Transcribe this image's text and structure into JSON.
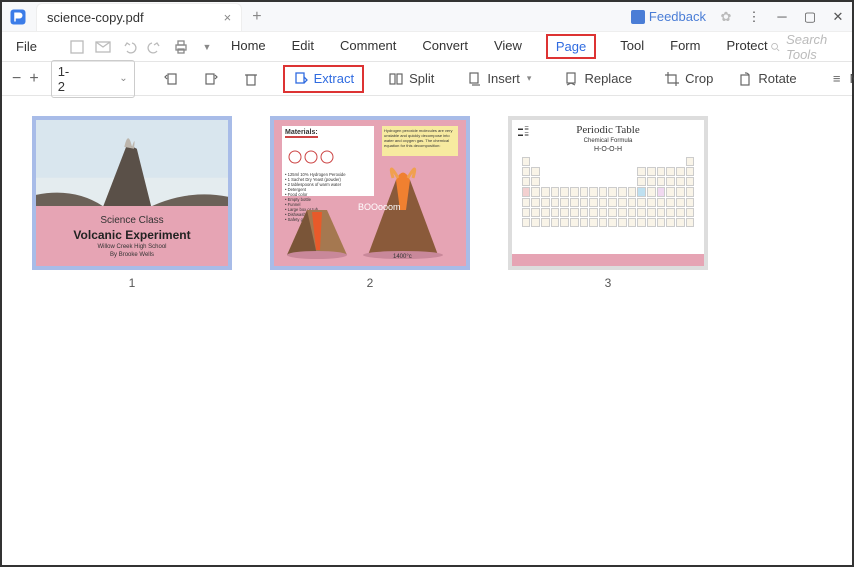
{
  "titlebar": {
    "filename": "science-copy.pdf",
    "feedback": "Feedback"
  },
  "menu": {
    "file": "File",
    "items": [
      "Home",
      "Edit",
      "Comment",
      "Convert",
      "View",
      "Page",
      "Tool",
      "Form",
      "Protect"
    ],
    "active": "Page",
    "search_placeholder": "Search Tools"
  },
  "toolbar": {
    "page_range": "1-2",
    "extract": "Extract",
    "split": "Split",
    "insert": "Insert",
    "replace": "Replace",
    "crop": "Crop",
    "rotate": "Rotate",
    "more": "More"
  },
  "thumbs": {
    "labels": [
      "1",
      "2",
      "3"
    ]
  },
  "slide1": {
    "line1": "Science Class",
    "line2": "Volcanic Experiment",
    "line3": "Willow Creek High School",
    "line4": "By Brooke Wells"
  },
  "slide2": {
    "materials_hdr": "Materials:",
    "materials_list": "• 125ml 10% Hydrogen Peroxide\n• 1 Sachet Dry Yeast (powder)\n• 2 tablespoons of warm water\n• Detergent\n• Food color\n• Empty bottle\n• Funnel\n• Large box or tub\n• Dishwashing gloves\n• Safety goggles",
    "note": "Hydrogen peroxide molecules are very unstable and quickly decompose into water and oxygen gas. The chemical equation for this decomposition:",
    "boom": "BOOooom",
    "temp": "1400°c"
  },
  "slide3": {
    "title": "Periodic Table",
    "sub": "Chemical Formula",
    "formula": "H-O-O-H"
  }
}
